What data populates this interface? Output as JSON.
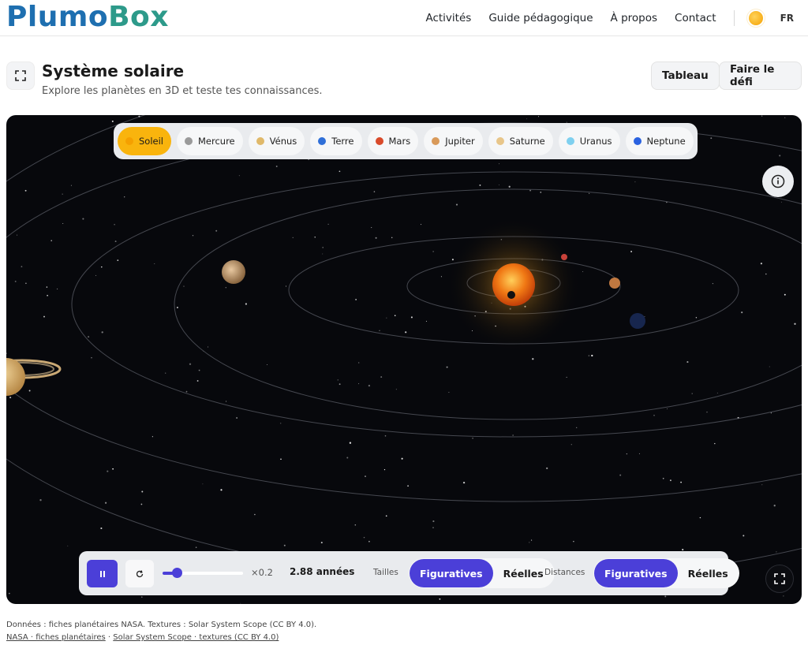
{
  "brand": {
    "part1": "Plumo",
    "part2": "Box"
  },
  "nav": {
    "items": [
      "Activités",
      "Guide pédagogique",
      "À propos",
      "Contact"
    ],
    "theme_icon": "sun-icon",
    "lang": "FR"
  },
  "page": {
    "title": "Système solaire",
    "subtitle": "Explore les planètes en 3D et teste tes connaissances.",
    "buttons": {
      "board": "Tableau",
      "challenge": "Faire le défi"
    }
  },
  "bodies": [
    {
      "label": "Soleil",
      "color": "#f5a000",
      "active": true
    },
    {
      "label": "Mercure",
      "color": "#9a9a9a"
    },
    {
      "label": "Vénus",
      "color": "#e0b96a"
    },
    {
      "label": "Terre",
      "color": "#2f6fd8"
    },
    {
      "label": "Mars",
      "color": "#d94a2a"
    },
    {
      "label": "Jupiter",
      "color": "#d99a5a"
    },
    {
      "label": "Saturne",
      "color": "#e8c68a"
    },
    {
      "label": "Uranus",
      "color": "#7fd0ef"
    },
    {
      "label": "Neptune",
      "color": "#2a62e0"
    }
  ],
  "controls": {
    "speed_label": "×0.2",
    "speed_fraction": 0.18,
    "elapsed": "2.88 années",
    "sizes_label": "Tailles",
    "sizes_options": [
      "Figuratives",
      "Réelles"
    ],
    "distances_label": "Distances",
    "distances_options": [
      "Figuratives",
      "Réelles"
    ],
    "accent": "#4b3fd8"
  },
  "footer": {
    "line1": "Données : fiches planétaires NASA. Textures : Solar System Scope (CC BY 4.0).",
    "link1": "NASA · fiches planétaires",
    "separator": " · ",
    "link2": "Solar System Scope · textures (CC BY 4.0)"
  }
}
